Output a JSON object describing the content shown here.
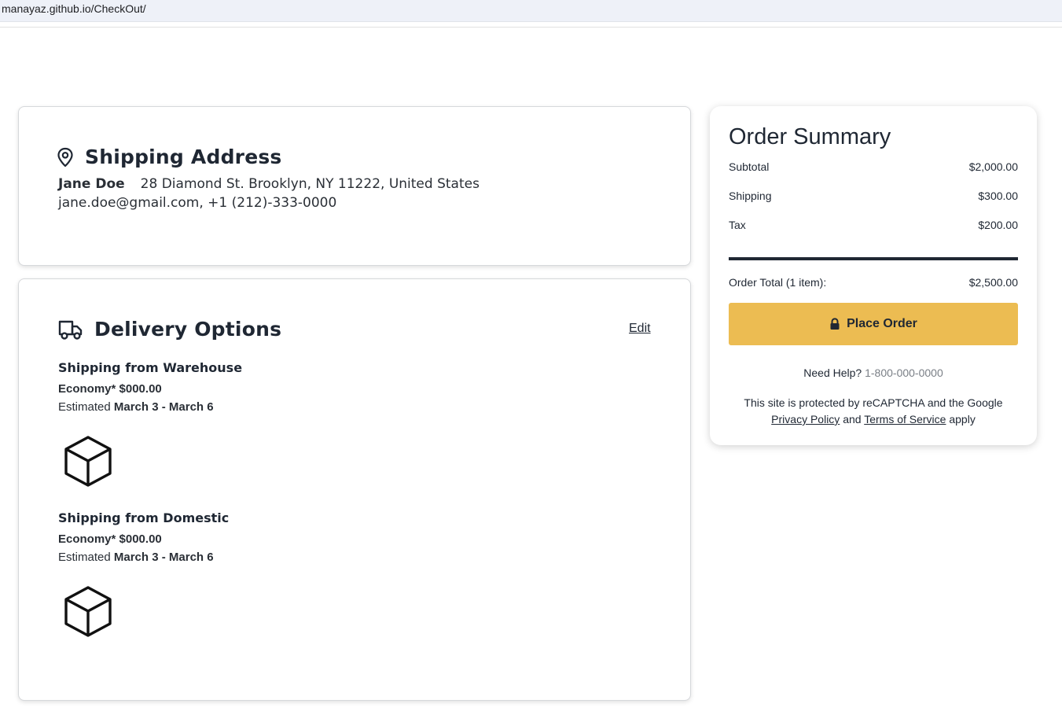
{
  "browser": {
    "url_host": "manayaz.github.io",
    "url_path": "/CheckOut/"
  },
  "shipping": {
    "title": "Shipping Address",
    "icon": "map-pin-icon",
    "name": "Jane Doe",
    "address": "28 Diamond St. Brooklyn, NY 11222, United States",
    "contact": "jane.doe@gmail.com, +1 (212)-333-0000"
  },
  "delivery": {
    "title": "Delivery Options",
    "icon": "truck-icon",
    "edit_label": "Edit",
    "groups": [
      {
        "title": "Shipping from Warehouse",
        "method": "Economy*",
        "price": "$000.00",
        "estimated_label": "Estimated",
        "dates": "March 3 - March 6",
        "icon": "box-icon"
      },
      {
        "title": "Shipping from Domestic",
        "method": "Economy*",
        "price": "$000.00",
        "estimated_label": "Estimated",
        "dates": "March 3 - March 6",
        "icon": "box-icon"
      }
    ]
  },
  "summary": {
    "title": "Order Summary",
    "rows": [
      {
        "label": "Subtotal",
        "value": "$2,000.00"
      },
      {
        "label": "Shipping",
        "value": "$300.00"
      },
      {
        "label": "Tax",
        "value": "$200.00"
      }
    ],
    "total_label": "Order Total (1 item):",
    "total_value": "$2,500.00",
    "place_order_label": "Place Order",
    "help_label": "Need Help?",
    "help_phone": "1-800-000-0000",
    "legal_prefix": "This site is protected by reCAPTCHA and the Google",
    "privacy_label": "Privacy Policy",
    "legal_and": "and",
    "terms_label": "Terms of Service",
    "legal_suffix": "apply"
  },
  "colors": {
    "accent_button": "#ecbc52",
    "text_dark": "#1f2733",
    "muted_phone": "#7a7f86"
  }
}
